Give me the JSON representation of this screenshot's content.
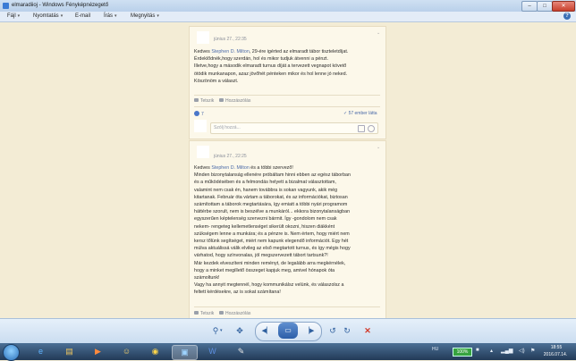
{
  "window": {
    "title": "elmaradiioj - Windows Fényképnézegető",
    "buttons": {
      "minimize": "–",
      "maximize": "□",
      "close": "✕"
    }
  },
  "menu": {
    "items": [
      "Fájl",
      "Nyomtatás",
      "E-mail",
      "Írás",
      "Megnyitás"
    ],
    "help": "?"
  },
  "post1": {
    "time": "június 27., 22:35",
    "lines": [
      [
        "Kedves ",
        "Stephen D. Milton",
        ", 29-ére igérted az elmaradt tábor tiszteletdíjat."
      ],
      "Érdeklődnék,hogy szerdán, hol és mikor tudjuk átvenni a pénzt.",
      "Illetve,hogy a második elmaradt turnus díját a tervezett vegnapot követő",
      "ötödik munkanapon, azaz jövőhét pénteken mikor és hol lenne jó neked.",
      "Köszönöm a választ."
    ],
    "like_label": "Tetszik",
    "comment_label": "Hozzászólás",
    "like_count": "7",
    "seen_by": "✓ 57 ember látta",
    "comment_placeholder": "Szólj hozzá..."
  },
  "post2": {
    "time": "június 27., 22:25",
    "lines": [
      [
        "Kedves ",
        "Stephen D. Milton",
        " és a többi szervező!"
      ],
      "Minden bizonytalanság ellenére próbáltam hinni ebben az egész táborban",
      "és a működésében és a felmondás helyett a bizalmat választottam,",
      "valamint nem csak én, hanem továbbra is sokan vagyunk, akik még",
      "kitartanak. Február óta vártam a táborokat, és az információkat, biztosan",
      "számítottam a táborok megtartására, így emiatt a többi nyári programom",
      "háttérbe szorult, nem is beszélve a munkáról... ekkora bizonytalanságban",
      "egyszerűen képtelenség szervezni bármit. Így -gondolom nem csak",
      "nekem- rengeteg kellemetlenséget sikerült okozni, hiszen diákként",
      "szükségem lenne a munkára; és a pénzre is. Nem értem, hogy miért nem",
      "kersz tőlünk segítséget, miért nem kapunk elegendő információt. Egy hét",
      "múlva aktuálissá válik elvileg az első megtartott turnus, és így mégis hogy",
      "várhatod, hogy színvonalas, jól megszervezett tábort tartsunk?!",
      "Már kezdek elveszíteni minden reményt, de legalább arra megkérnélek,",
      "hogy a minket megillető összeget kapjuk meg, amivel hónapok óta",
      "számoltunk!",
      "Vagy ha annyit megtennél, hogy kommunikálsz velünk, és válaszolsz a",
      "feltett kérdésekre, az is sokat számítana!"
    ],
    "like_label": "Tetszik",
    "comment_label": "Hozzászólás"
  },
  "toolbar": {
    "zoom_icon": "zoom-icon",
    "fit_icon": "fit-icon",
    "prev_icon": "previous-icon",
    "slideshow_icon": "slideshow-icon",
    "next_icon": "next-icon",
    "rotate_left_icon": "rotate-left-icon",
    "rotate_right_icon": "rotate-right-icon",
    "delete_icon": "delete-icon"
  },
  "taskbar": {
    "lang": "HU",
    "battery": "100%",
    "time": "18:55",
    "date": "2016.07.14."
  },
  "colors": {
    "viewer_bg": "#f3ecd5",
    "card_bg": "#fcf8ea",
    "link_blue": "#4a6aa8",
    "taskbar_dark": "#223a57",
    "toolbar_blue": "#2e5f9e",
    "delete_red": "#d23a2a"
  }
}
